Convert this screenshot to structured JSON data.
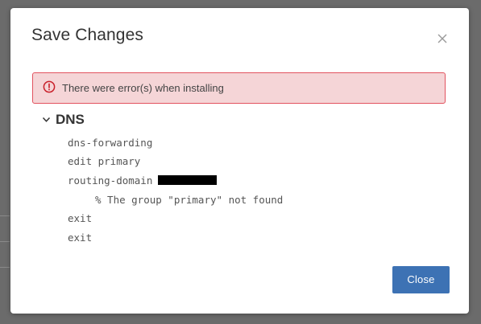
{
  "dialog": {
    "title": "Save Changes",
    "close_icon": "close-icon"
  },
  "alert": {
    "icon": "error-circle-icon",
    "message": "There were error(s) when installing",
    "colors": {
      "background": "#f5d5d7",
      "border": "#e2535f",
      "icon": "#c9202a"
    }
  },
  "section": {
    "toggle_icon": "chevron-down-icon",
    "title": "DNS",
    "lines": [
      "dns-forwarding",
      "edit primary",
      "routing-domain",
      "% The group \"primary\" not found",
      "exit",
      "exit"
    ]
  },
  "footer": {
    "close_label": "Close",
    "button_color": "#3d72b4"
  }
}
